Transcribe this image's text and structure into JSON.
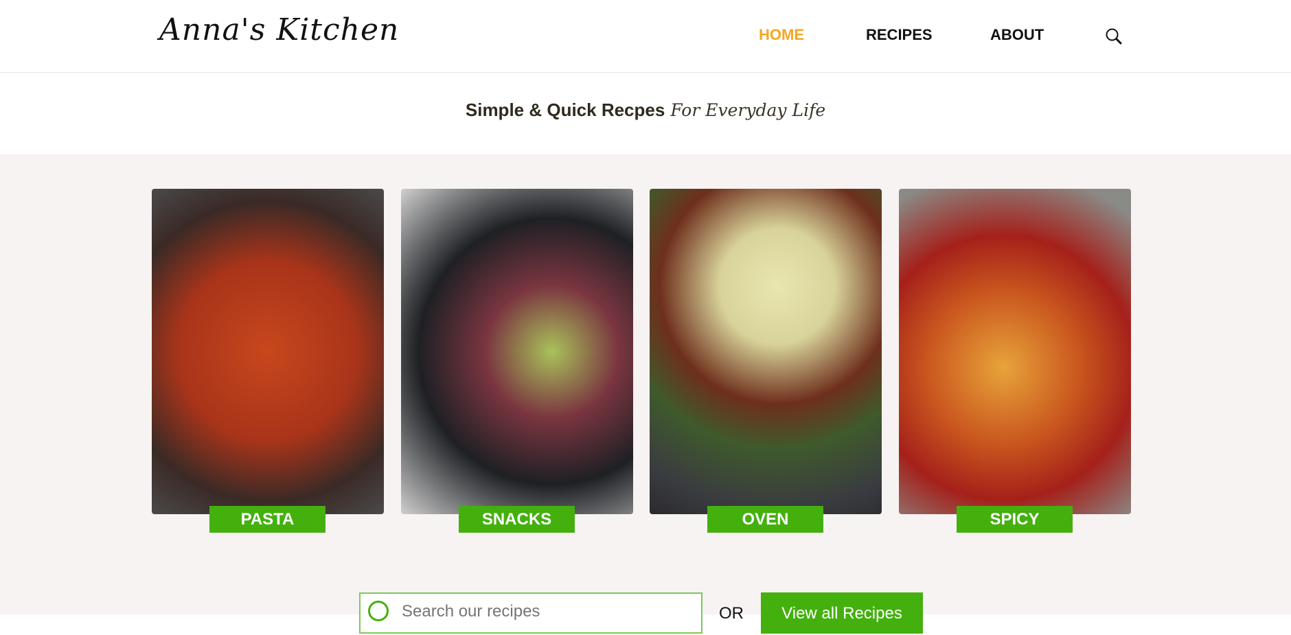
{
  "header": {
    "logo": "Anna's Kitchen",
    "nav": [
      {
        "label": "HOME",
        "active": true
      },
      {
        "label": "RECIPES"
      },
      {
        "label": "ABOUT"
      }
    ],
    "search_icon": "search-icon"
  },
  "tagline": {
    "bold": "Simple & Quick Recpes",
    "script": "For Everyday Life"
  },
  "categories": [
    {
      "label": "PASTA"
    },
    {
      "label": "SNACKS"
    },
    {
      "label": "OVEN"
    },
    {
      "label": "SPICY"
    }
  ],
  "search": {
    "placeholder": "Search our recipes",
    "or": "OR",
    "view_all": "View all Recipes"
  },
  "colors": {
    "accent": "#44b00e",
    "active_nav": "#f5a623",
    "background": "#f7f3f2"
  }
}
